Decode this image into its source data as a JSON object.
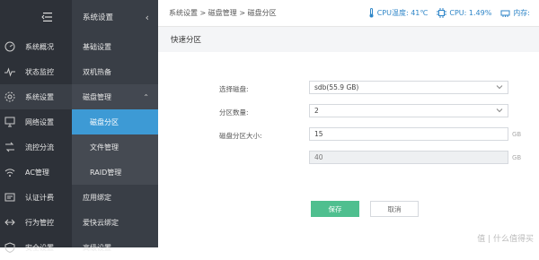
{
  "nav1": {
    "items": [
      {
        "label": "系统概况",
        "icon": "dashboard-icon"
      },
      {
        "label": "状态监控",
        "icon": "pulse-icon"
      },
      {
        "label": "系统设置",
        "icon": "gear-icon",
        "active": true
      },
      {
        "label": "网络设置",
        "icon": "network-icon"
      },
      {
        "label": "流控分流",
        "icon": "flow-icon"
      },
      {
        "label": "AC管理",
        "icon": "wifi-icon"
      },
      {
        "label": "认证计费",
        "icon": "card-icon"
      },
      {
        "label": "行为管控",
        "icon": "control-icon"
      },
      {
        "label": "安全设置",
        "icon": "shield-icon"
      }
    ]
  },
  "nav2": {
    "title": "系统设置",
    "items": [
      {
        "label": "基础设置"
      },
      {
        "label": "双机热备"
      },
      {
        "label": "磁盘管理",
        "group": true
      },
      {
        "label": "磁盘分区",
        "sub": true,
        "active": true
      },
      {
        "label": "文件管理",
        "sub": true
      },
      {
        "label": "RAID管理",
        "sub": true
      },
      {
        "label": "应用绑定"
      },
      {
        "label": "爱快云绑定"
      },
      {
        "label": "高级设置"
      }
    ]
  },
  "header": {
    "breadcrumb": "系统设置 > 磁盘管理 > 磁盘分区",
    "cpu_temp": "CPU温度: 41℃",
    "cpu": "CPU: 1.49%",
    "mem": "内存:"
  },
  "panel": {
    "title": "快速分区"
  },
  "form": {
    "disk_label": "选择磁盘:",
    "disk_value": "sdb(55.9 GB)",
    "count_label": "分区数量:",
    "count_value": "2",
    "size_label": "磁盘分区大小:",
    "size1": "15",
    "size2": "40",
    "unit": "GB",
    "save": "保存",
    "cancel": "取消"
  },
  "watermark": "值 | 什么值得买",
  "colors": {
    "accent": "#3d9ad5",
    "save": "#4fbf8f",
    "sidebar": "#2d3138"
  }
}
